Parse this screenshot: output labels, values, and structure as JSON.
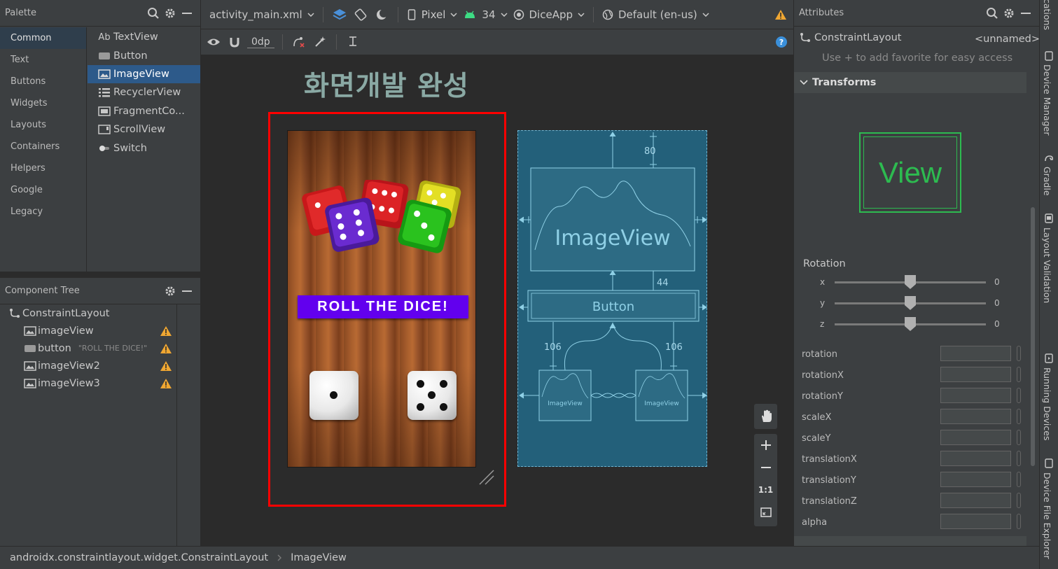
{
  "palette": {
    "title": "Palette",
    "categories": [
      "Common",
      "Text",
      "Buttons",
      "Widgets",
      "Layouts",
      "Containers",
      "Helpers",
      "Google",
      "Legacy"
    ],
    "items": [
      "TextView",
      "Button",
      "ImageView",
      "RecyclerView",
      "FragmentCo...",
      "ScrollView",
      "Switch"
    ],
    "textview_prefix": "Ab"
  },
  "tree": {
    "title": "Component Tree",
    "root": "ConstraintLayout",
    "nodes": [
      {
        "name": "imageView",
        "note": ""
      },
      {
        "name": "button",
        "note": "\"ROLL THE DICE!\""
      },
      {
        "name": "imageView2",
        "note": ""
      },
      {
        "name": "imageView3",
        "note": ""
      }
    ]
  },
  "toolbar": {
    "file": "activity_main.xml",
    "device": "Pixel",
    "api": "34",
    "theme": "DiceApp",
    "locale": "Default (en-us)",
    "margin": "0dp"
  },
  "design": {
    "heading": "화면개발 완성",
    "roll_button": "ROLL THE DICE!",
    "blueprint_image": "ImageView",
    "blueprint_button": "Button",
    "blueprint_small": "ImageView",
    "margin_top": "80",
    "margin_mid": "44",
    "margin_left": "106",
    "margin_right": "106"
  },
  "zoom": {
    "one_to_one": "1:1"
  },
  "attributes": {
    "title": "Attributes",
    "component": "ConstraintLayout",
    "id": "<unnamed>",
    "hint": "Use + to add favorite for easy access",
    "section": "Transforms",
    "view_label": "View",
    "rotation_label": "Rotation",
    "axes": [
      {
        "axis": "x",
        "value": "0"
      },
      {
        "axis": "y",
        "value": "0"
      },
      {
        "axis": "z",
        "value": "0"
      }
    ],
    "fields": [
      "rotation",
      "rotationX",
      "rotationY",
      "scaleX",
      "scaleY",
      "translationX",
      "translationY",
      "translationZ",
      "alpha"
    ]
  },
  "side_tabs": [
    "cations",
    "Device Manager",
    "Gradle",
    "Layout Validation",
    "Running Devices",
    "Device File Explorer"
  ],
  "status": {
    "path": "androidx.constraintlayout.widget.ConstraintLayout",
    "leaf": "ImageView"
  },
  "colors": {
    "accent": "#2f65ca",
    "warning": "#f0a732",
    "selection": "#ff0000",
    "blueprint": "#23607a",
    "roll_button": "#6200ee",
    "view_green": "#2dbb50"
  }
}
